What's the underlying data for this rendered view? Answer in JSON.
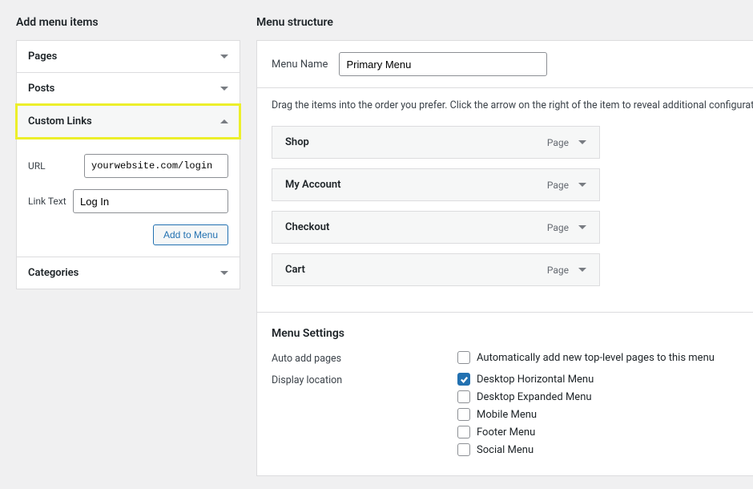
{
  "add_items_heading": "Add menu items",
  "menu_structure_heading": "Menu structure",
  "accordion": {
    "pages_label": "Pages",
    "posts_label": "Posts",
    "custom_links_label": "Custom Links",
    "categories_label": "Categories"
  },
  "custom_link_form": {
    "url_label": "URL",
    "url_value": "yourwebsite.com/login",
    "link_text_label": "Link Text",
    "link_text_value": "Log In",
    "add_button": "Add to Menu"
  },
  "menu_name_label": "Menu Name",
  "menu_name_value": "Primary Menu",
  "instructions": "Drag the items into the order you prefer. Click the arrow on the right of the item to reveal additional configurat",
  "menu_items": [
    {
      "name": "Shop",
      "type": "Page"
    },
    {
      "name": "My Account",
      "type": "Page"
    },
    {
      "name": "Checkout",
      "type": "Page"
    },
    {
      "name": "Cart",
      "type": "Page"
    }
  ],
  "settings": {
    "heading": "Menu Settings",
    "auto_add_label": "Auto add pages",
    "auto_add_option": "Automatically add new top-level pages to this menu",
    "display_label": "Display location",
    "display_options": [
      {
        "label": "Desktop Horizontal Menu",
        "checked": true
      },
      {
        "label": "Desktop Expanded Menu",
        "checked": false
      },
      {
        "label": "Mobile Menu",
        "checked": false
      },
      {
        "label": "Footer Menu",
        "checked": false
      },
      {
        "label": "Social Menu",
        "checked": false
      }
    ]
  }
}
